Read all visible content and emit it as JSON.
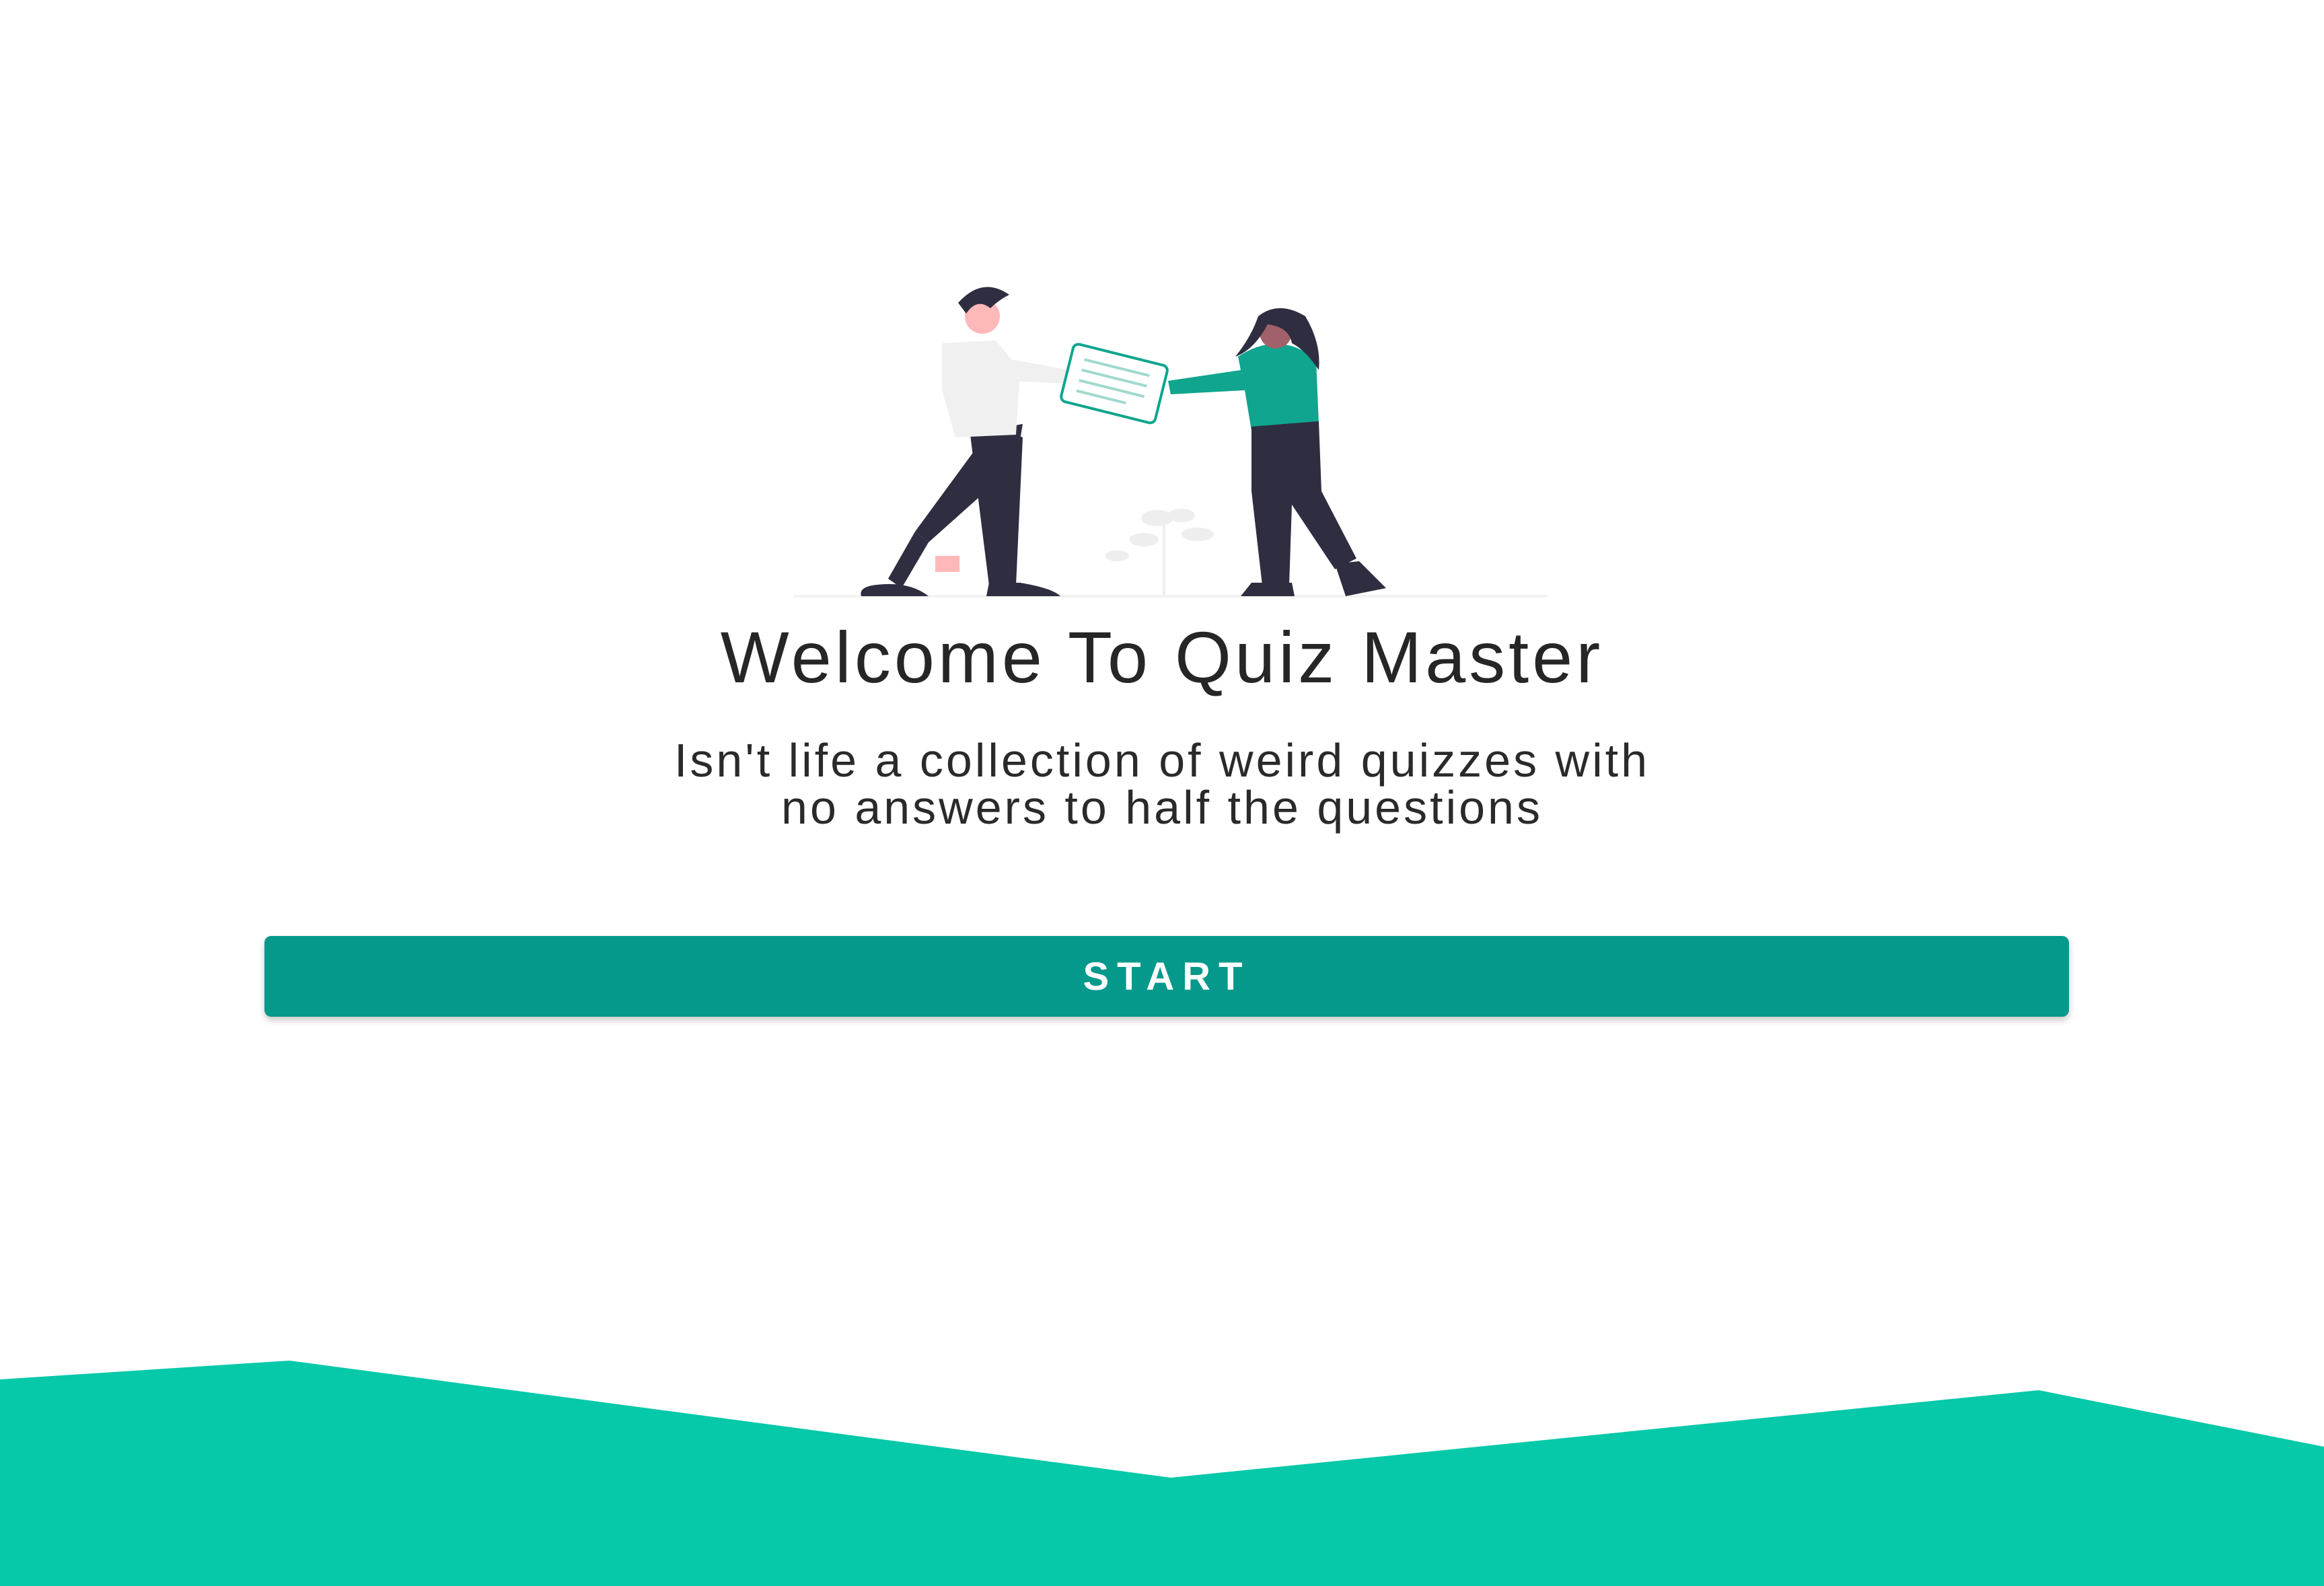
{
  "welcome": {
    "title": "Welcome To Quiz Master",
    "subtitle_line1": "Isn't life a collection of weird quizzes with",
    "subtitle_line2": "no answers to half the questions",
    "start_label": "START"
  },
  "colors": {
    "accent": "#04998b",
    "wave": "#05c9a8",
    "shirt_teal": "#0fa58e",
    "dark": "#2f2e41"
  },
  "illustration": {
    "icon": "two-people-exchanging-quiz-sheet-illustration"
  }
}
